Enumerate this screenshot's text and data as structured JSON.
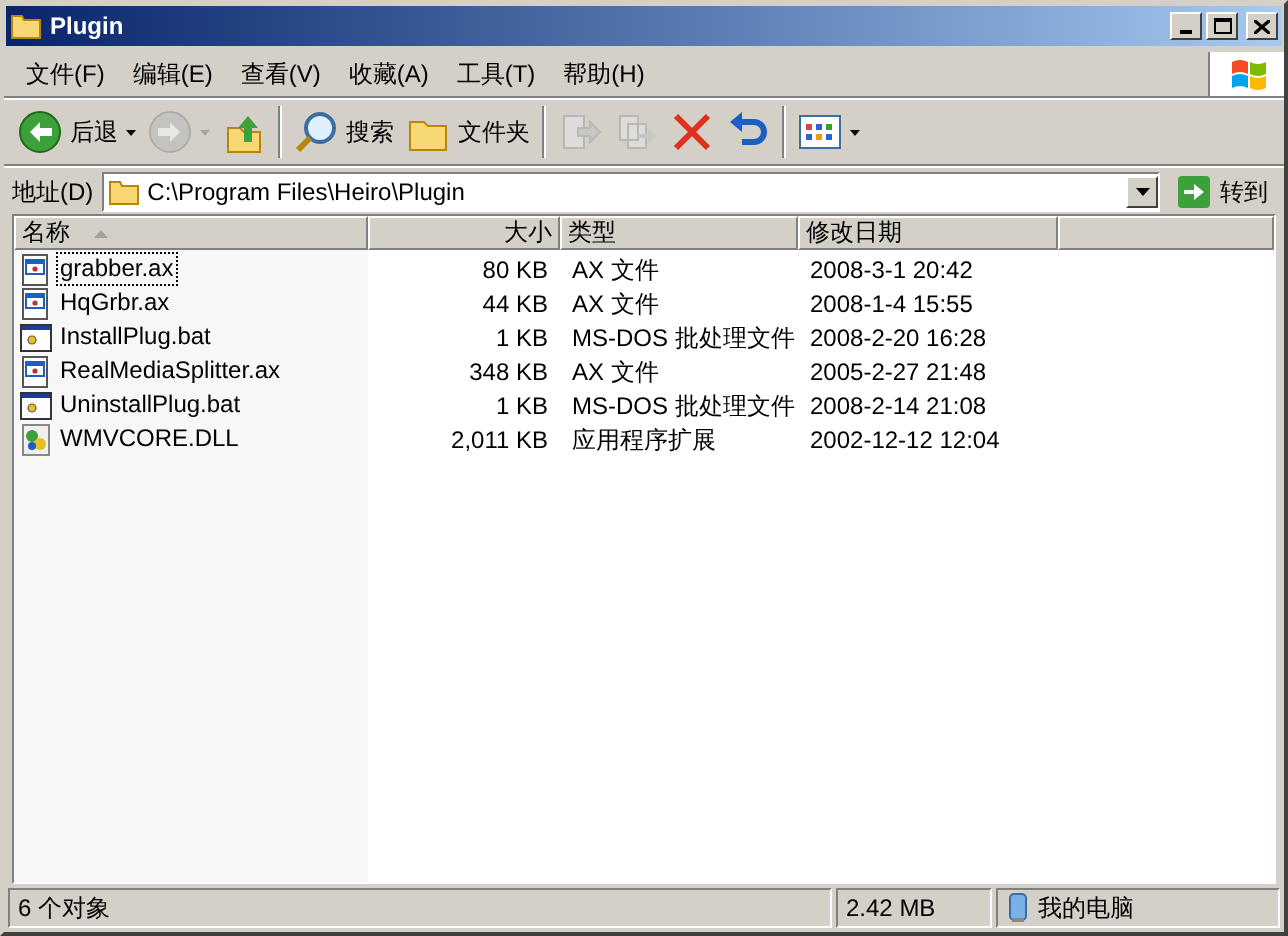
{
  "window": {
    "title": "Plugin"
  },
  "menu": [
    "文件(F)",
    "编辑(E)",
    "查看(V)",
    "收藏(A)",
    "工具(T)",
    "帮助(H)"
  ],
  "toolbar": [
    {
      "kind": "back",
      "label": "后退",
      "disabled": false
    },
    {
      "kind": "forward",
      "disabled": true
    },
    {
      "kind": "up",
      "disabled": false
    },
    {
      "kind": "search",
      "label": "搜索",
      "disabled": false
    },
    {
      "kind": "folders",
      "label": "文件夹",
      "disabled": false
    },
    {
      "kind": "move",
      "disabled": true
    },
    {
      "kind": "copy",
      "disabled": true
    },
    {
      "kind": "delete",
      "disabled": false
    },
    {
      "kind": "undo",
      "disabled": false
    },
    {
      "kind": "views",
      "disabled": false
    }
  ],
  "address": {
    "label": "地址(D)",
    "value": "C:\\Program Files\\Heiro\\Plugin",
    "go": "转到"
  },
  "table": {
    "columns": [
      "名称",
      "大小",
      "类型",
      "修改日期"
    ],
    "rows": [
      {
        "kind": "ax",
        "name": "grabber.ax",
        "size": "80 KB",
        "type": "AX 文件",
        "modified": "2008-3-1 20:42",
        "focused": true
      },
      {
        "kind": "ax",
        "name": "HqGrbr.ax",
        "size": "44 KB",
        "type": "AX 文件",
        "modified": "2008-1-4 15:55",
        "focused": false
      },
      {
        "kind": "bat",
        "name": "InstallPlug.bat",
        "size": "1 KB",
        "type": "MS-DOS 批处理文件",
        "modified": "2008-2-20 16:28",
        "focused": false
      },
      {
        "kind": "ax",
        "name": "RealMediaSplitter.ax",
        "size": "348 KB",
        "type": "AX 文件",
        "modified": "2005-2-27 21:48",
        "focused": false
      },
      {
        "kind": "bat",
        "name": "UninstallPlug.bat",
        "size": "1 KB",
        "type": "MS-DOS 批处理文件",
        "modified": "2008-2-14 21:08",
        "focused": false
      },
      {
        "kind": "dll",
        "name": "WMVCORE.DLL",
        "size": "2,011 KB",
        "type": "应用程序扩展",
        "modified": "2002-12-12 12:04",
        "focused": false
      }
    ]
  },
  "status_bar": {
    "count": "6 个对象",
    "size": "2.42 MB",
    "location": "我的电脑"
  }
}
